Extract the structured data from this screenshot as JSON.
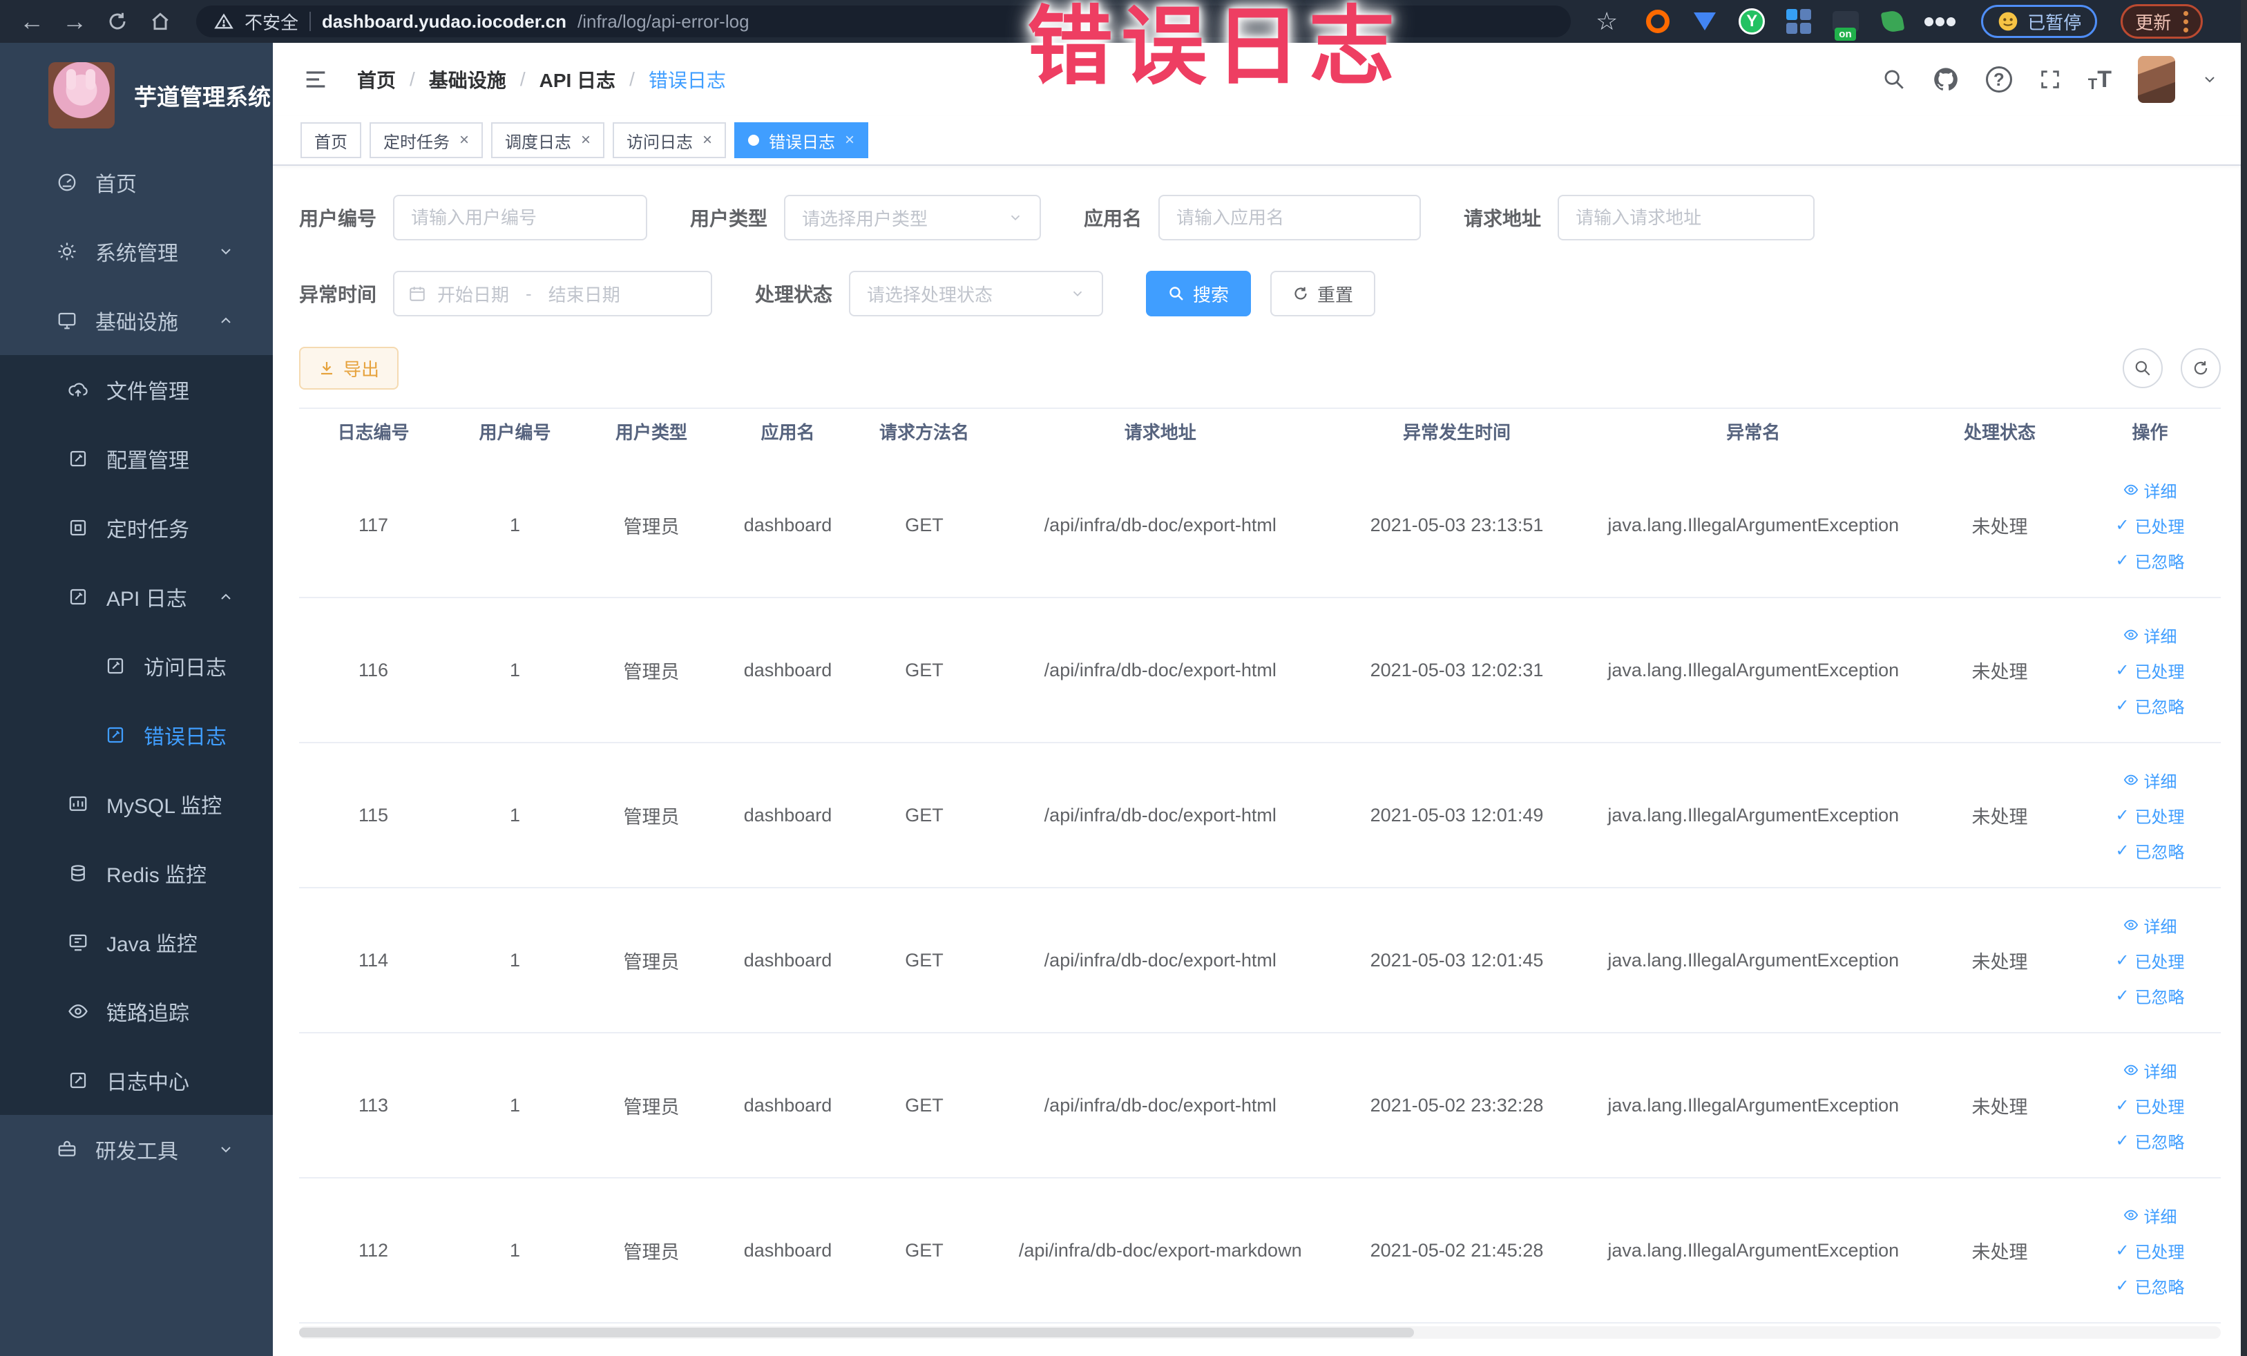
{
  "colors": {
    "accent": "#409eff",
    "warning": "#e6a23c",
    "overlay_pink": "#ee3e62",
    "sidebar_bg": "#304156",
    "submenu_bg": "#1f2d3d"
  },
  "overlay_title": "错误日志",
  "browser": {
    "security_label": "不安全",
    "url_host": "dashboard.yudao.iocoder.cn",
    "url_path": "/infra/log/api-error-log",
    "paused_label": "已暂停",
    "update_label": "更新",
    "ext_on_badge": "on"
  },
  "sidebar": {
    "app_title": "芋道管理系统",
    "items": [
      {
        "label": "首页",
        "icon": "dashboard-icon",
        "level": 1
      },
      {
        "label": "系统管理",
        "icon": "gear-icon",
        "level": 1,
        "chevron": "down"
      },
      {
        "label": "基础设施",
        "icon": "monitor-icon",
        "level": 1,
        "chevron": "up",
        "expanded": true
      },
      {
        "label": "文件管理",
        "icon": "cloud-upload-icon",
        "level": 2
      },
      {
        "label": "配置管理",
        "icon": "edit-icon",
        "level": 2
      },
      {
        "label": "定时任务",
        "icon": "job-icon",
        "level": 2
      },
      {
        "label": "API 日志",
        "icon": "log-icon",
        "level": 2,
        "chevron": "up",
        "expanded": true
      },
      {
        "label": "访问日志",
        "icon": "log-icon",
        "level": 3
      },
      {
        "label": "错误日志",
        "icon": "log-icon",
        "level": 3,
        "active": true
      },
      {
        "label": "MySQL 监控",
        "icon": "chart-icon",
        "level": 2
      },
      {
        "label": "Redis 监控",
        "icon": "database-icon",
        "level": 2
      },
      {
        "label": "Java 监控",
        "icon": "java-monitor-icon",
        "level": 2
      },
      {
        "label": "链路追踪",
        "icon": "eye-icon",
        "level": 2
      },
      {
        "label": "日志中心",
        "icon": "log-icon",
        "level": 2
      },
      {
        "label": "研发工具",
        "icon": "toolbox-icon",
        "level": 1,
        "chevron": "down"
      }
    ]
  },
  "header": {
    "breadcrumb": [
      "首页",
      "基础设施",
      "API 日志",
      "错误日志"
    ],
    "separator": "/"
  },
  "tabs": [
    {
      "label": "首页"
    },
    {
      "label": "定时任务",
      "closable": true
    },
    {
      "label": "调度日志",
      "closable": true
    },
    {
      "label": "访问日志",
      "closable": true
    },
    {
      "label": "错误日志",
      "closable": true,
      "active": true
    }
  ],
  "filters": {
    "user_id": {
      "label": "用户编号",
      "placeholder": "请输入用户编号"
    },
    "user_type": {
      "label": "用户类型",
      "placeholder": "请选择用户类型"
    },
    "app_name": {
      "label": "应用名",
      "placeholder": "请输入应用名"
    },
    "request_url": {
      "label": "请求地址",
      "placeholder": "请输入请求地址"
    },
    "exception_time": {
      "label": "异常时间",
      "start_placeholder": "开始日期",
      "separator": "-",
      "end_placeholder": "结束日期"
    },
    "process_status": {
      "label": "处理状态",
      "placeholder": "请选择处理状态"
    },
    "search_label": "搜索",
    "reset_label": "重置"
  },
  "toolbar": {
    "export_label": "导出"
  },
  "table": {
    "columns": [
      "日志编号",
      "用户编号",
      "用户类型",
      "应用名",
      "请求方法名",
      "请求地址",
      "异常发生时间",
      "异常名",
      "处理状态",
      "操作"
    ],
    "actions": {
      "detail": "详细",
      "processed": "已处理",
      "ignored": "已忽略"
    },
    "rows": [
      {
        "id": "117",
        "user_id": "1",
        "user_type": "管理员",
        "app": "dashboard",
        "method": "GET",
        "url": "/api/infra/db-doc/export-html",
        "time": "2021-05-03 23:13:51",
        "exception": "java.lang.IllegalArgumentException",
        "status": "未处理"
      },
      {
        "id": "116",
        "user_id": "1",
        "user_type": "管理员",
        "app": "dashboard",
        "method": "GET",
        "url": "/api/infra/db-doc/export-html",
        "time": "2021-05-03 12:02:31",
        "exception": "java.lang.IllegalArgumentException",
        "status": "未处理"
      },
      {
        "id": "115",
        "user_id": "1",
        "user_type": "管理员",
        "app": "dashboard",
        "method": "GET",
        "url": "/api/infra/db-doc/export-html",
        "time": "2021-05-03 12:01:49",
        "exception": "java.lang.IllegalArgumentException",
        "status": "未处理"
      },
      {
        "id": "114",
        "user_id": "1",
        "user_type": "管理员",
        "app": "dashboard",
        "method": "GET",
        "url": "/api/infra/db-doc/export-html",
        "time": "2021-05-03 12:01:45",
        "exception": "java.lang.IllegalArgumentException",
        "status": "未处理"
      },
      {
        "id": "113",
        "user_id": "1",
        "user_type": "管理员",
        "app": "dashboard",
        "method": "GET",
        "url": "/api/infra/db-doc/export-html",
        "time": "2021-05-02 23:32:28",
        "exception": "java.lang.IllegalArgumentException",
        "status": "未处理"
      },
      {
        "id": "112",
        "user_id": "1",
        "user_type": "管理员",
        "app": "dashboard",
        "method": "GET",
        "url": "/api/infra/db-doc/export-markdown",
        "time": "2021-05-02 21:45:28",
        "exception": "java.lang.IllegalArgumentException",
        "status": "未处理"
      }
    ]
  }
}
